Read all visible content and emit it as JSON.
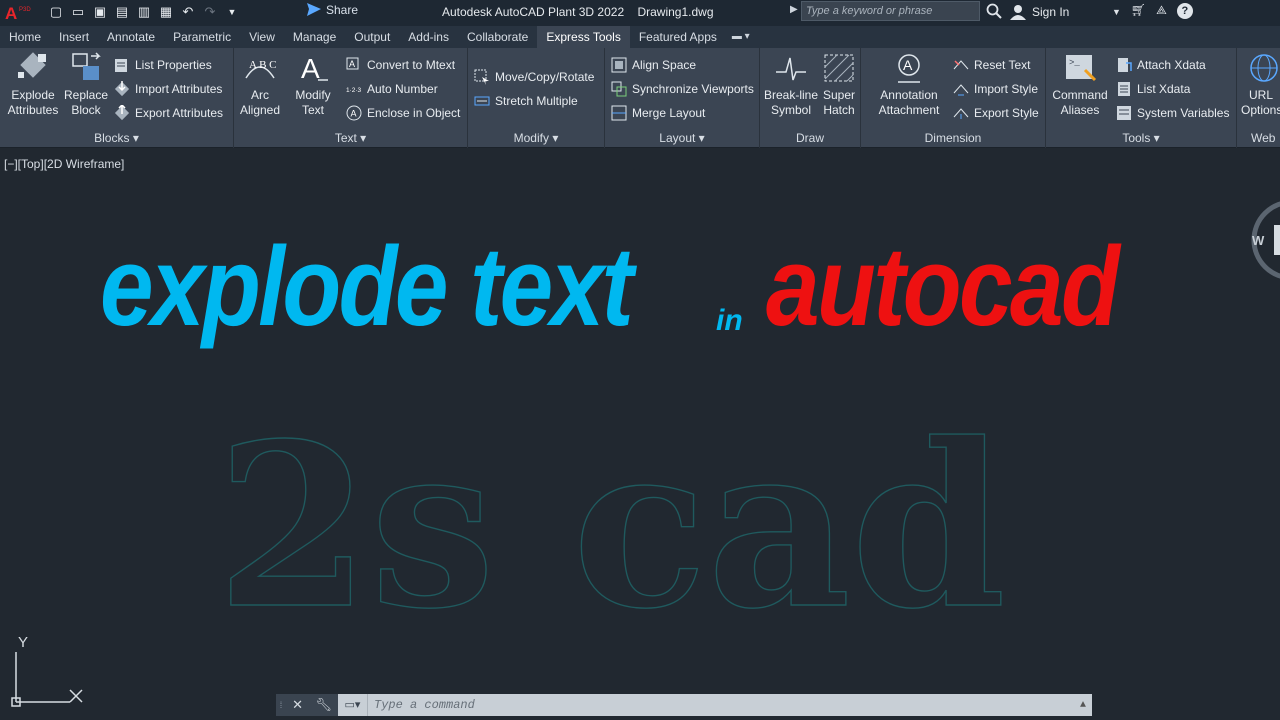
{
  "titlebar": {
    "app_badge": "P3D",
    "share_label": "Share",
    "app_title": "Autodesk AutoCAD Plant 3D 2022",
    "document": "Drawing1.dwg",
    "search_placeholder": "Type a keyword or phrase",
    "signin_label": "Sign In"
  },
  "tabs": [
    {
      "label": "Home"
    },
    {
      "label": "Insert"
    },
    {
      "label": "Annotate"
    },
    {
      "label": "Parametric"
    },
    {
      "label": "View"
    },
    {
      "label": "Manage"
    },
    {
      "label": "Output"
    },
    {
      "label": "Add-ins"
    },
    {
      "label": "Collaborate"
    },
    {
      "label": "Express Tools",
      "active": true
    },
    {
      "label": "Featured Apps"
    }
  ],
  "ribbon": {
    "blocks": {
      "label": "Blocks",
      "explode_attributes": "Explode Attributes",
      "replace_block": "Replace Block",
      "list_properties": "List Properties",
      "import_attributes": "Import Attributes",
      "export_attributes": "Export Attributes"
    },
    "text": {
      "label": "Text",
      "arc_aligned": "Arc Aligned",
      "modify_text": "Modify Text",
      "convert_to_mtext": "Convert to Mtext",
      "auto_number": "Auto Number",
      "enclose_in_object": "Enclose in Object"
    },
    "modify": {
      "label": "Modify",
      "move_copy_rotate": "Move/Copy/Rotate",
      "stretch_multiple": "Stretch Multiple"
    },
    "layout": {
      "label": "Layout",
      "align_space": "Align Space",
      "sync_viewports": "Synchronize Viewports",
      "merge_layout": "Merge Layout"
    },
    "draw": {
      "label": "Draw",
      "break_line_symbol": "Break-line Symbol",
      "super_hatch": "Super Hatch"
    },
    "dimension": {
      "label": "Dimension",
      "annotation_attachment": "Annotation Attachment",
      "reset_text": "Reset Text",
      "import_style": "Import Style",
      "export_style": "Export Style"
    },
    "tools": {
      "label": "Tools",
      "command_aliases": "Command Aliases",
      "attach_xdata": "Attach Xdata",
      "list_xdata": "List Xdata",
      "system_variables": "System Variables"
    },
    "web": {
      "label": "Web",
      "url_options": "URL Options"
    }
  },
  "viewport": {
    "label": "[−][Top][2D Wireframe]",
    "headline_word1": "explode text",
    "headline_word2": "in",
    "headline_word3": "autocad",
    "outline_text": "2s cad",
    "compass_letter": "W",
    "ucs_y": "Y"
  },
  "command_line": {
    "placeholder": "Type a command"
  },
  "colors": {
    "headline_blue": "#00b8f0",
    "headline_red": "#ee1111",
    "outline_teal": "#1f5a5e",
    "background": "#212830"
  }
}
